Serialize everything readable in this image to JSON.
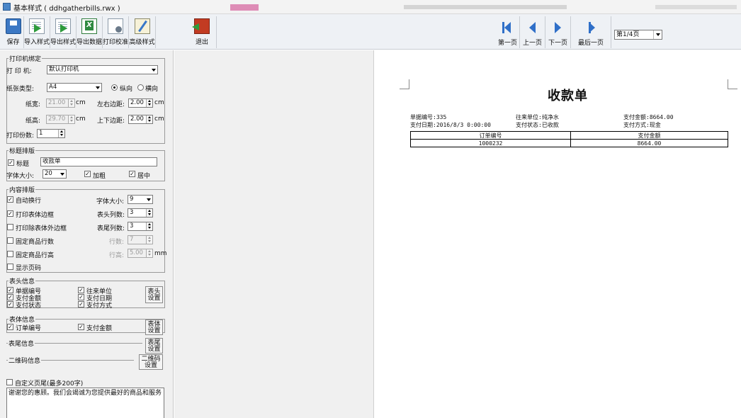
{
  "window": {
    "title": "基本样式 ( ddhgatherbills.rwx )"
  },
  "toolbar": {
    "save": "保存",
    "import_style": "导入样式",
    "export_style": "导出样式",
    "export_data": "导出数据",
    "print_calibrate": "打印校准",
    "advanced_style": "高级样式",
    "exit": "退出"
  },
  "nav": {
    "first": "第一页",
    "prev": "上一页",
    "next": "下一页",
    "last": "最后一页",
    "page_select": "第1/4页"
  },
  "printer_group": {
    "legend": "打印机绑定",
    "printer_label": "打 印 机:",
    "printer_value": "默认打印机",
    "paper_type_label": "纸张类型:",
    "paper_type_value": "A4",
    "portrait_label": "纵向",
    "landscape_label": "横向",
    "paper_width_label": "纸宽:",
    "paper_width_value": "21.00",
    "lr_margin_label": "左右边距:",
    "lr_margin_value": "2.00",
    "paper_height_label": "纸高:",
    "paper_height_value": "29.70",
    "tb_margin_label": "上下边距:",
    "tb_margin_value": "2.00",
    "unit_cm": "cm",
    "copies_label": "打印份数:",
    "copies_value": "1"
  },
  "title_group": {
    "legend": "标题排版",
    "title_check_label": "标题",
    "title_value": "收款单",
    "font_size_label": "字体大小:",
    "font_size_value": "20",
    "bold_label": "加粗",
    "center_label": "居中"
  },
  "content_group": {
    "legend": "内容排版",
    "auto_wrap": "自动换行",
    "font_size_label": "字体大小:",
    "font_size_value": "9",
    "print_table_border": "打印表体边框",
    "header_cols_label": "表头列数:",
    "header_cols_value": "3",
    "print_outer_border": "打印除表体外边框",
    "footer_cols_label": "表尾列数:",
    "footer_cols_value": "3",
    "fixed_rows": "固定商品行数",
    "rows_label": "行数:",
    "rows_value": "7",
    "fixed_row_height": "固定商品行高",
    "row_height_label": "行高:",
    "row_height_value": "5.00",
    "unit_mm": "mm",
    "show_page_no": "显示页码"
  },
  "header_info": {
    "legend": "表头信息",
    "items": [
      "单据编号",
      "往来单位",
      "支付金额",
      "支付日期",
      "支付状态",
      "支付方式"
    ],
    "settings": "表头设置"
  },
  "body_info": {
    "legend": "表体信息",
    "items": [
      "订单编号",
      "支付金额"
    ],
    "settings": "表体设置"
  },
  "footer_info": {
    "legend": "表尾信息",
    "settings": "表尾设置"
  },
  "qr_info": {
    "legend": "二维码信息",
    "settings": "二维码设置"
  },
  "custom_footer": {
    "label": "自定义页尾(最多200字)",
    "text": "谢谢您的惠顾。我们会竭诚为您提供最好的商品和服务"
  },
  "preview": {
    "title": "收款单",
    "fields": [
      {
        "label": "单据编号:",
        "value": "335"
      },
      {
        "label": "往来单位:",
        "value": "纯净水"
      },
      {
        "label": "支付金额:",
        "value": "8664.00"
      },
      {
        "label": "支付日期:",
        "value": "2016/8/3 0:00:00"
      },
      {
        "label": "支付状态:",
        "value": "已收款"
      },
      {
        "label": "支付方式:",
        "value": "现金"
      }
    ],
    "table": {
      "headers": [
        "订单编号",
        "支付金额"
      ],
      "rows": [
        [
          "1000232",
          "8664.00"
        ]
      ]
    }
  }
}
